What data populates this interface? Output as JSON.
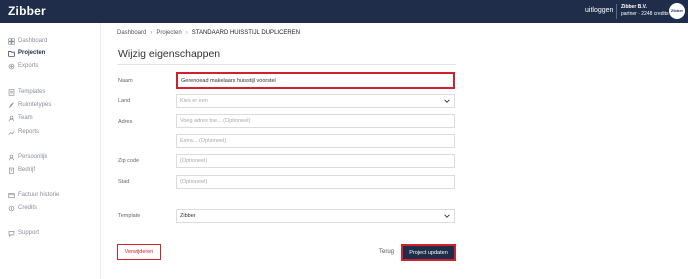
{
  "topbar": {
    "logo": "Zibber",
    "logout": "uitloggen",
    "company_name": "Zibber B.V.",
    "company_sub": "partner · 2248 credits",
    "avatar_text": "Zibber"
  },
  "sidebar": {
    "items": [
      {
        "label": "Dashboard",
        "icon": "dashboard-icon"
      },
      {
        "label": "Projecten",
        "icon": "folder-icon"
      },
      {
        "label": "Exports",
        "icon": "export-icon"
      },
      {
        "label": "Templates",
        "icon": "template-icon"
      },
      {
        "label": "Ruimtetypes",
        "icon": "rocket-icon"
      },
      {
        "label": "Team",
        "icon": "team-icon"
      },
      {
        "label": "Reports",
        "icon": "chart-icon"
      },
      {
        "label": "Persoonlijk",
        "icon": "user-icon"
      },
      {
        "label": "Bedrijf",
        "icon": "building-icon"
      },
      {
        "label": "Factuur historie",
        "icon": "invoice-icon"
      },
      {
        "label": "Credits",
        "icon": "credits-icon"
      },
      {
        "label": "Support",
        "icon": "support-icon"
      }
    ]
  },
  "breadcrumb": {
    "items": [
      "Dashboard",
      "Projecten",
      "STANDAARD HUISSTIJL DUPLICEREN"
    ]
  },
  "page_title": "Wijzig eigenschappen",
  "form": {
    "name_label": "Naam",
    "name_value": "Gerenoead makelaars huisstijl voorstel",
    "country_label": "Land",
    "country_placeholder": "Kies er een",
    "address_label": "Adres",
    "address1_placeholder": "Voeg adres toe... (Optioneel)",
    "address2_placeholder": "Extra... (Optioneel)",
    "zip_label": "Zip code",
    "zip_placeholder": "(Optioneel)",
    "city_label": "Stad",
    "city_placeholder": "(Optioneel)",
    "template_label": "Template",
    "template_value": "Zibber"
  },
  "actions": {
    "delete": "Verwijderen",
    "back": "Terug",
    "update": "Project updaten"
  },
  "colors": {
    "navy": "#1f2d4a",
    "highlight_red": "#d0212e"
  }
}
